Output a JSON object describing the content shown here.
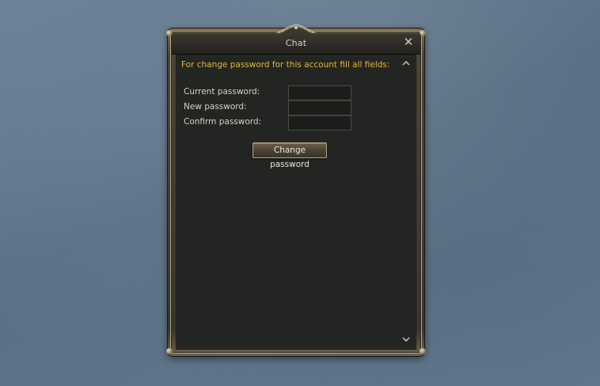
{
  "window": {
    "title": "Chat",
    "close_icon": "close-icon"
  },
  "panel": {
    "header": "For change password for this account fill all fields:",
    "scroll_up_icon": "chevron-up-icon",
    "scroll_down_icon": "chevron-down-icon"
  },
  "form": {
    "fields": [
      {
        "label": "Current password:",
        "value": ""
      },
      {
        "label": "New password:",
        "value": ""
      },
      {
        "label": "Confirm password:",
        "value": ""
      }
    ],
    "submit_label": "Change password"
  },
  "colors": {
    "background": "#5f7589",
    "header_text": "#e6b830",
    "panel": "#232523",
    "frame_gold": "#b7a98a"
  }
}
